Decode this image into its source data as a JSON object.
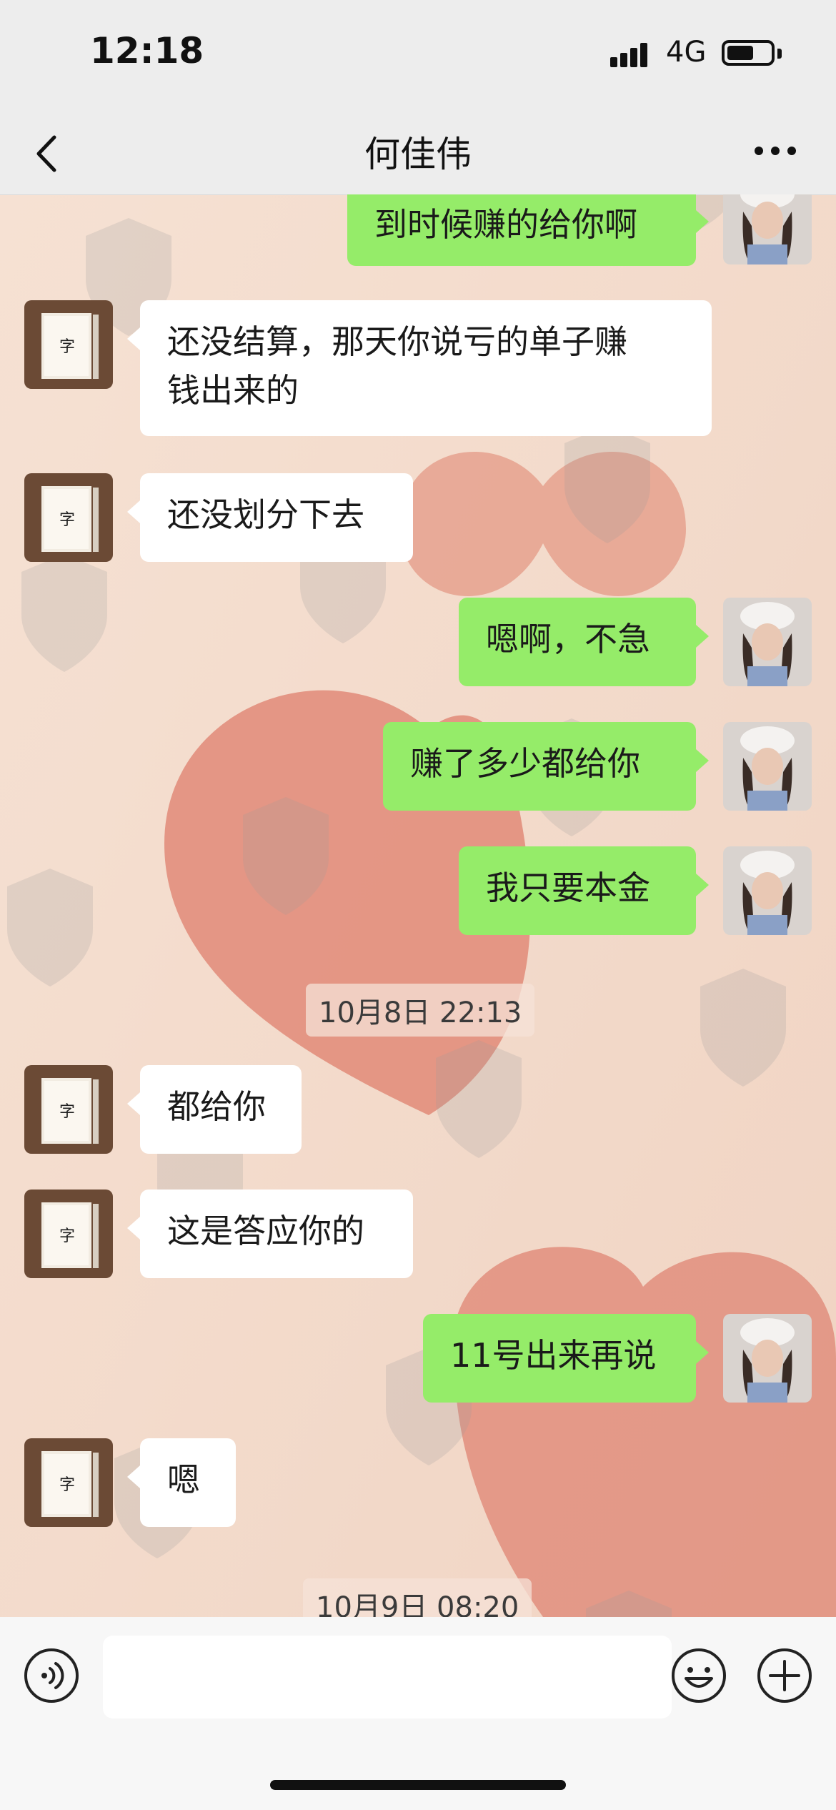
{
  "status_bar": {
    "time": "12:18",
    "network": "4G",
    "battery_level": 0.55
  },
  "header": {
    "title": "何佳伟",
    "back_icon": "chevron-left-icon",
    "more_icon": "more-dots-icon"
  },
  "messages": [
    {
      "direction": "out",
      "text": "到时候赚的给你啊"
    },
    {
      "direction": "in",
      "line1": "还没结算，那天你说亏的单子赚",
      "line2": "钱出来的"
    },
    {
      "direction": "in",
      "text": "还没划分下去"
    },
    {
      "direction": "out",
      "text": "嗯啊，不急"
    },
    {
      "direction": "out",
      "text": "赚了多少都给你"
    },
    {
      "direction": "out",
      "text": "我只要本金"
    },
    {
      "type": "timestamp",
      "text": "10月8日 22:13"
    },
    {
      "direction": "in",
      "text": "都给你"
    },
    {
      "direction": "in",
      "text": "这是答应你的"
    },
    {
      "direction": "out",
      "text": "11号出来再说"
    },
    {
      "direction": "in",
      "text": "嗯"
    },
    {
      "type": "timestamp",
      "text": "10月9日 08:20"
    }
  ],
  "input_bar": {
    "voice_icon": "voice-icon",
    "input_value": "",
    "emoji_icon": "emoji-icon",
    "plus_icon": "plus-icon"
  },
  "colors": {
    "outgoing_bubble": "#95ec69",
    "incoming_bubble": "#ffffff",
    "chat_background": "#f3dccd",
    "heart": "#e08a78"
  }
}
